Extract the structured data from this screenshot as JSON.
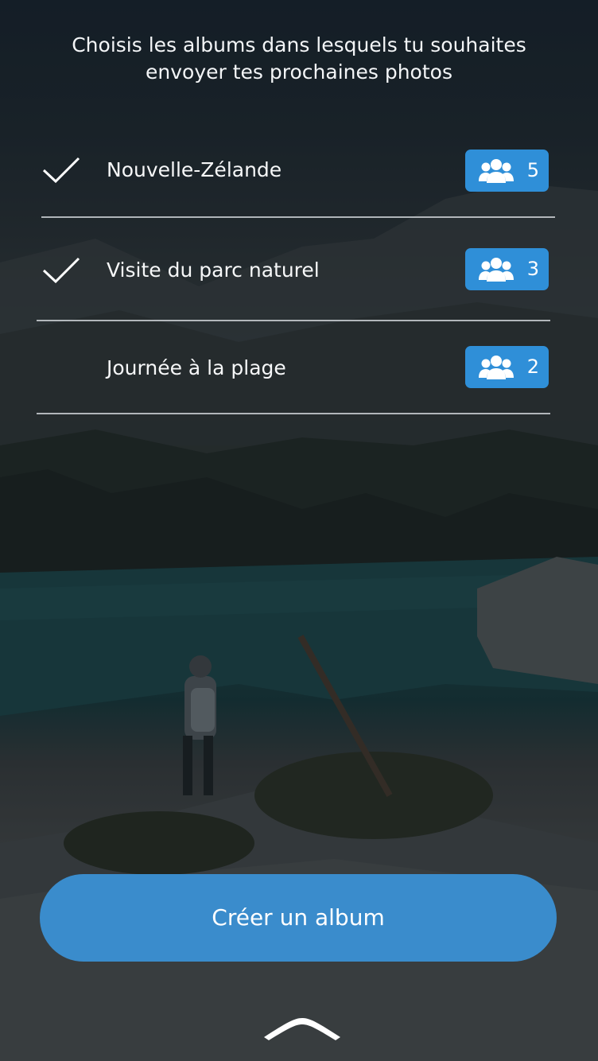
{
  "header": {
    "line1": "Choisis les albums dans lesquels tu souhaites",
    "line2": "envoyer tes prochaines photos"
  },
  "albums": [
    {
      "name": "Nouvelle-Zélande",
      "members": "5",
      "selected": true
    },
    {
      "name": "Visite du parc naturel",
      "members": "3",
      "selected": true
    },
    {
      "name": "Journée à la plage",
      "members": "2",
      "selected": false
    }
  ],
  "actions": {
    "create_album": "Créer un album"
  },
  "icons": {
    "check": "checkmark-icon",
    "members": "group-icon",
    "expand": "chevron-up-icon"
  },
  "colors": {
    "accent": "#2f8fd8",
    "button": "#3a8ccc"
  }
}
